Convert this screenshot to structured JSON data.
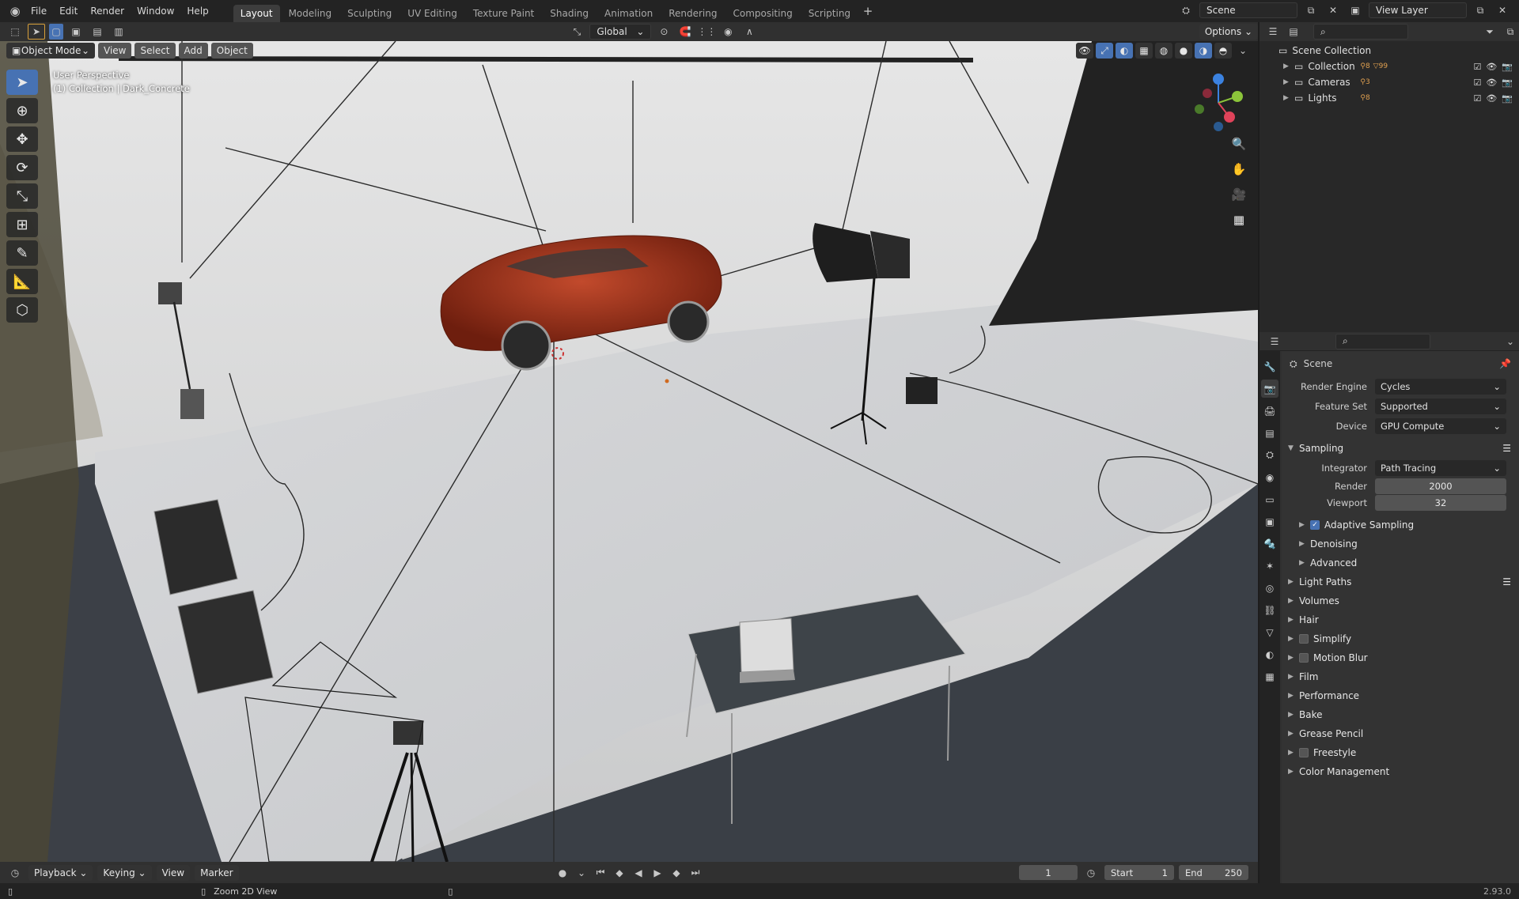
{
  "menu": {
    "file": "File",
    "edit": "Edit",
    "render": "Render",
    "window": "Window",
    "help": "Help"
  },
  "workspaces": [
    "Layout",
    "Modeling",
    "Sculpting",
    "UV Editing",
    "Texture Paint",
    "Shading",
    "Animation",
    "Rendering",
    "Compositing",
    "Scripting"
  ],
  "active_workspace": "Layout",
  "scene_name": "Scene",
  "view_layer": "View Layer",
  "viewport": {
    "transform_orientation": "Global",
    "options_label": "Options",
    "mode": "Object Mode",
    "menus": {
      "view": "View",
      "select": "Select",
      "add": "Add",
      "object": "Object"
    },
    "perspective_label": "User Perspective",
    "collection_label": "(1) Collection | Dark_Concrete"
  },
  "outliner": {
    "root": "Scene Collection",
    "items": [
      {
        "label": "Collection",
        "badge": "8",
        "badge2": "99"
      },
      {
        "label": "Cameras",
        "badge": "3"
      },
      {
        "label": "Lights",
        "badge": "8"
      }
    ]
  },
  "properties": {
    "context": "Scene",
    "render_engine_label": "Render Engine",
    "render_engine": "Cycles",
    "feature_set_label": "Feature Set",
    "feature_set": "Supported",
    "device_label": "Device",
    "device": "GPU Compute",
    "sampling": "Sampling",
    "integrator_label": "Integrator",
    "integrator": "Path Tracing",
    "render_label": "Render",
    "render_samples": "2000",
    "viewport_label": "Viewport",
    "viewport_samples": "32",
    "subpanels": [
      "Adaptive Sampling",
      "Denoising",
      "Advanced"
    ],
    "panels": [
      "Light Paths",
      "Volumes",
      "Hair",
      "Simplify",
      "Motion Blur",
      "Film",
      "Performance",
      "Bake",
      "Grease Pencil",
      "Freestyle",
      "Color Management"
    ]
  },
  "timeline": {
    "playback": "Playback",
    "keying": "Keying",
    "view": "View",
    "marker": "Marker",
    "current_frame": "1",
    "start_label": "Start",
    "start": "1",
    "end_label": "End",
    "end": "250"
  },
  "status": {
    "hint": "Zoom 2D View",
    "version": "2.93.0"
  },
  "colors": {
    "accent": "#4772b3",
    "car": "#a3321b",
    "axis_x": "#e0435a",
    "axis_y": "#8bc43a",
    "axis_z": "#3b82e0"
  }
}
